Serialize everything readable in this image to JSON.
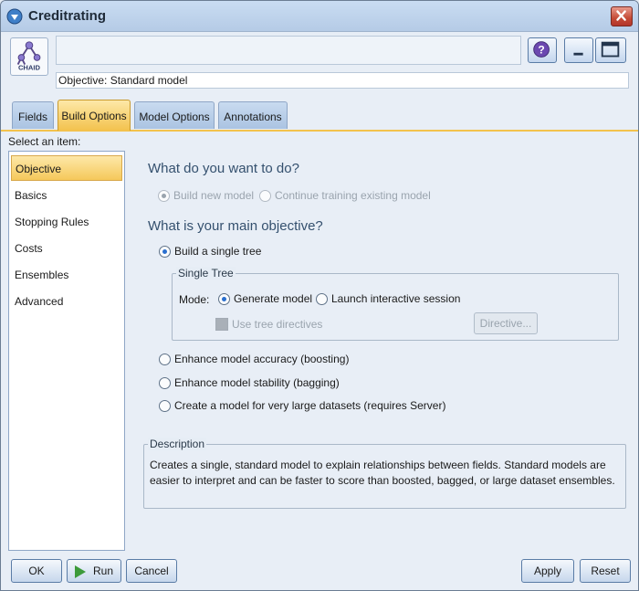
{
  "window": {
    "title": "Creditrating"
  },
  "header": {
    "model_icon_label": "CHAID",
    "objective_text": "Objective: Standard model"
  },
  "tabs": [
    {
      "label": "Fields"
    },
    {
      "label": "Build Options",
      "active": true
    },
    {
      "label": "Model Options"
    },
    {
      "label": "Annotations"
    }
  ],
  "sidebar": {
    "label": "Select an item:",
    "items": [
      {
        "label": "Objective",
        "selected": true
      },
      {
        "label": "Basics"
      },
      {
        "label": "Stopping Rules"
      },
      {
        "label": "Costs"
      },
      {
        "label": "Ensembles"
      },
      {
        "label": "Advanced"
      }
    ]
  },
  "main": {
    "q1_title": "What do you want to do?",
    "build_new": "Build new model",
    "continue_training": "Continue training existing model",
    "q2_title": "What is your main objective?",
    "build_single_tree": "Build a single tree",
    "single_tree_group": "Single Tree",
    "mode_label": "Mode:",
    "generate_model": "Generate model",
    "launch_interactive": "Launch interactive session",
    "use_tree_directives": "Use tree directives",
    "directive_button": "Directive...",
    "boosting": "Enhance model accuracy (boosting)",
    "bagging": "Enhance model stability (bagging)",
    "large_datasets": "Create a model for very large datasets (requires Server)",
    "description_label": "Description",
    "description_text": "Creates a single, standard model to explain relationships between fields.  Standard models are easier to interpret and can be faster to score than boosted, bagged, or large dataset ensembles."
  },
  "footer": {
    "ok": "OK",
    "run": "Run",
    "cancel": "Cancel",
    "apply": "Apply",
    "reset": "Reset"
  },
  "colors": {
    "accent": "#f3c24d",
    "section_title": "#34506e",
    "run_green": "#3c9a3a"
  }
}
